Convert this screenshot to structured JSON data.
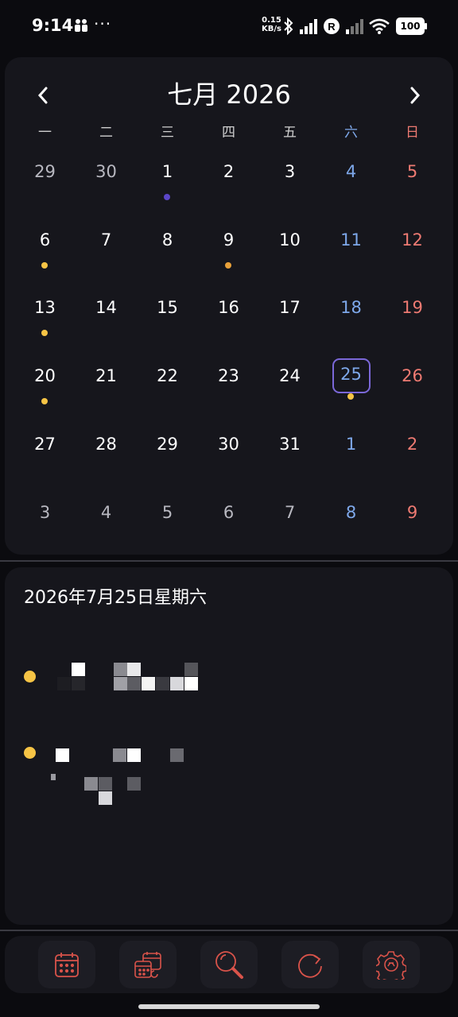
{
  "status_bar": {
    "time": "9:14",
    "more": "···",
    "speed_value": "0.15",
    "speed_unit": "KB/s",
    "roaming": "R",
    "battery": "100"
  },
  "calendar": {
    "title": "七月 2026",
    "prev_glyph": "‹",
    "next_glyph": "›",
    "weekdays": [
      "一",
      "二",
      "三",
      "四",
      "五",
      "六",
      "日"
    ],
    "weeks": [
      [
        "29",
        "30",
        "1",
        "2",
        "3",
        "4",
        "5"
      ],
      [
        "6",
        "7",
        "8",
        "9",
        "10",
        "11",
        "12"
      ],
      [
        "13",
        "14",
        "15",
        "16",
        "17",
        "18",
        "19"
      ],
      [
        "20",
        "21",
        "22",
        "23",
        "24",
        "25",
        "26"
      ],
      [
        "27",
        "28",
        "29",
        "30",
        "31",
        "1",
        "2"
      ],
      [
        "3",
        "4",
        "5",
        "6",
        "7",
        "8",
        "9"
      ]
    ],
    "selected": "25",
    "colors": {
      "selected_border": "#7b68d8",
      "saturday": "#7ea8ea",
      "sunday": "#ee7a72",
      "event_yellow": "#f6c445",
      "event_orange": "#e8a13a",
      "event_purple": "#5b46c8"
    }
  },
  "events_panel": {
    "date_title": "2026年7月25日星期六",
    "events": [
      {
        "dot_color": "#f6c445",
        "content": "pixelated"
      },
      {
        "dot_color": "#f6c445",
        "content": "pixelated"
      }
    ]
  },
  "bottom_nav": {
    "items": [
      {
        "icon": "calendar-month-icon"
      },
      {
        "icon": "calendar-sync-icon"
      },
      {
        "icon": "search-icon"
      },
      {
        "icon": "refresh-icon"
      },
      {
        "icon": "settings-icon"
      }
    ],
    "icon_color": "#d9534a"
  }
}
